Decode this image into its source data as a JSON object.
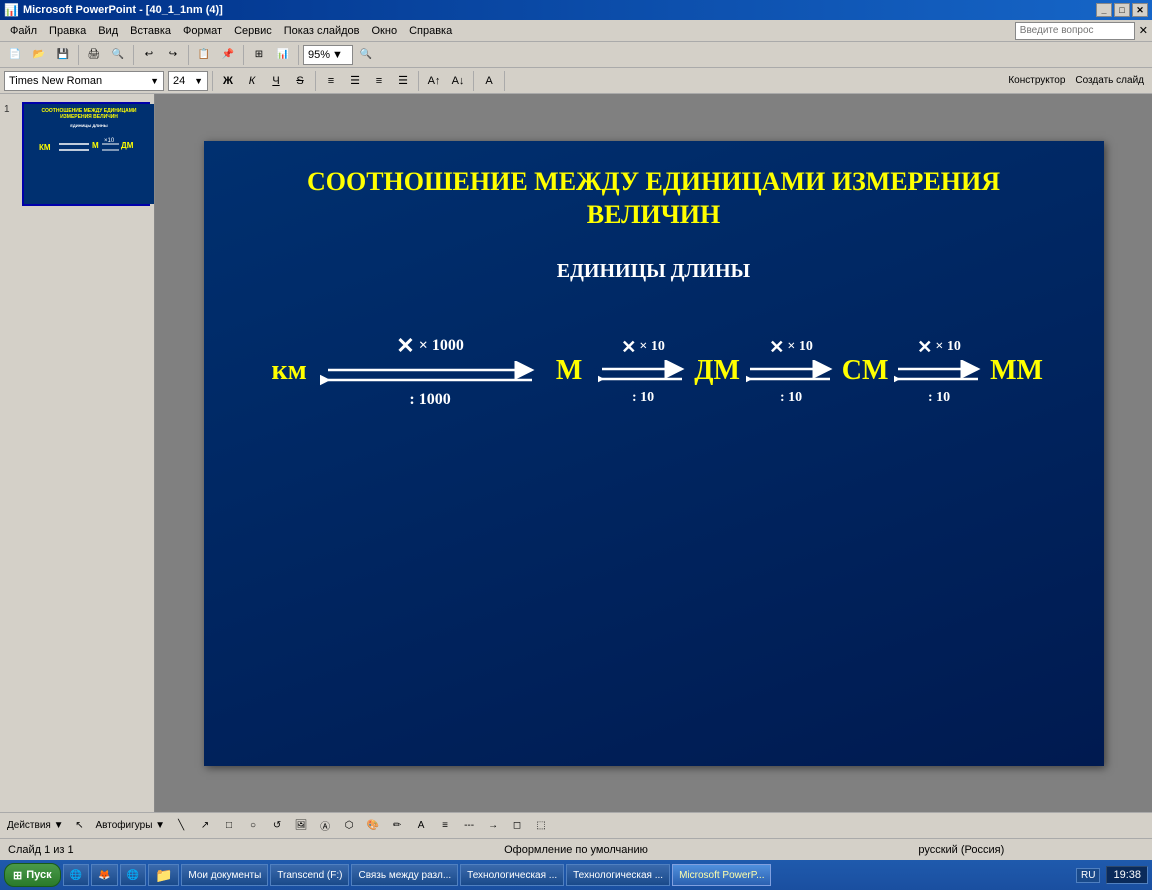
{
  "window": {
    "title": "Microsoft PowerPoint - [40_1_1nm (4)]",
    "controls": [
      "_",
      "□",
      "✕"
    ]
  },
  "menubar": {
    "items": [
      "Файл",
      "Правка",
      "Вид",
      "Вставка",
      "Формат",
      "Сервис",
      "Показ слайдов",
      "Окно",
      "Справка"
    ],
    "search_placeholder": "Введите вопрос"
  },
  "toolbar": {
    "zoom": "95%",
    "zoom_icon": "🔍"
  },
  "format_toolbar": {
    "font_name": "Times New Roman",
    "font_size": "24",
    "bold": "Ж",
    "italic": "К",
    "underline": "Ч",
    "strikethrough": "S",
    "right_buttons": [
      "Конструктор",
      "Создать слайд"
    ]
  },
  "slide": {
    "title_line1": "СООТНОШЕНИЕ МЕЖДУ ЕДИНИЦАМИ ИЗМЕРЕНИЯ",
    "title_line2": "ВЕЛИЧИН",
    "section_title": "ЕДИНИЦЫ ДЛИНЫ",
    "units": [
      "км",
      "м",
      "дм",
      "см",
      "мм"
    ],
    "large_arrow": {
      "top_label": "× 1000",
      "bot_label": ": 1000"
    },
    "small_arrows": [
      {
        "top_label": "× 10",
        "bot_label": ": 10"
      },
      {
        "top_label": "× 10",
        "bot_label": ": 10"
      },
      {
        "top_label": "× 10",
        "bot_label": ": 10"
      }
    ]
  },
  "status_bar": {
    "slide_info": "Слайд 1 из 1",
    "theme": "Оформление по умолчанию",
    "language": "русский (Россия)"
  },
  "taskbar": {
    "start_label": "Пуск",
    "items": [
      {
        "label": "Мои документы",
        "active": false
      },
      {
        "label": "Transcend (F:)",
        "active": false
      },
      {
        "label": "Связь между разл...",
        "active": false
      },
      {
        "label": "Технологическая ...",
        "active": false
      },
      {
        "label": "Технологическая ...",
        "active": false
      },
      {
        "label": "Microsoft PowerP...",
        "active": true
      }
    ],
    "lang": "RU",
    "time": "19:38"
  }
}
